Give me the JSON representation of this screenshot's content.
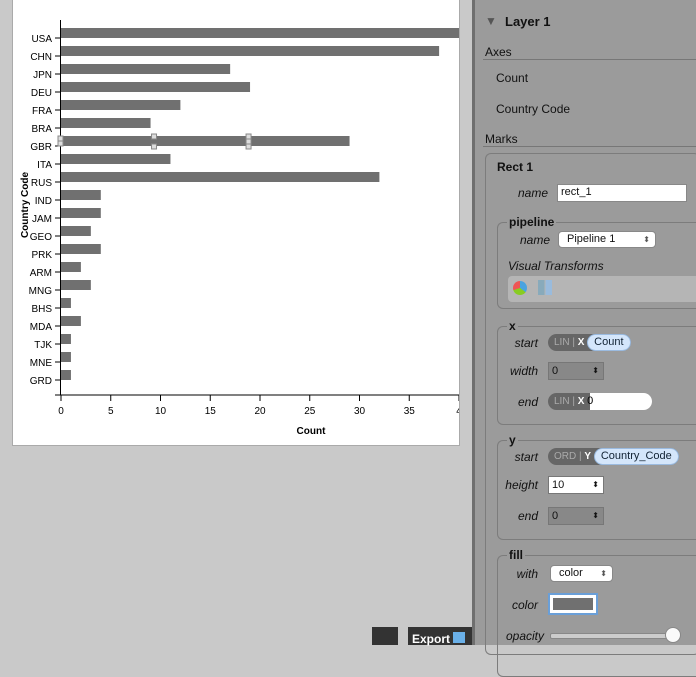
{
  "chart_data": {
    "type": "bar",
    "orientation": "horizontal",
    "categories": [
      "USA",
      "CHN",
      "JPN",
      "DEU",
      "FRA",
      "BRA",
      "GBR",
      "ITA",
      "RUS",
      "IND",
      "JAM",
      "GEO",
      "PRK",
      "ARM",
      "MNG",
      "BHS",
      "MDA",
      "TJK",
      "MNE",
      "GRD"
    ],
    "values": [
      40,
      38,
      17,
      19,
      12,
      9,
      29,
      11,
      32,
      4,
      4,
      3,
      4,
      2,
      3,
      1,
      2,
      1,
      1,
      1
    ],
    "xlabel": "Count",
    "ylabel": "Country Code",
    "xlim": [
      0,
      40
    ],
    "xticks": [
      "0",
      "5",
      "10",
      "15",
      "20",
      "25",
      "30",
      "35",
      "4"
    ],
    "bar_color": "#707070",
    "grid": false
  },
  "panel": {
    "layer_title": "Layer 1",
    "axes_heading": "Axes",
    "axes": [
      "Count",
      "Country Code"
    ],
    "marks_heading": "Marks",
    "mark_title": "Rect 1",
    "name_label": "name",
    "name_value": "rect_1",
    "pipeline_heading": "pipeline",
    "pipeline_name_label": "name",
    "pipeline_value": "Pipeline 1",
    "visual_transforms": "Visual Transforms",
    "x": {
      "heading": "x",
      "start_label": "start",
      "start_scale": "LIN",
      "start_axis": "X",
      "start_field": "Count",
      "width_label": "width",
      "width_value": "0",
      "end_label": "end",
      "end_scale": "LIN",
      "end_axis": "X",
      "end_value": "0"
    },
    "y": {
      "heading": "y",
      "start_label": "start",
      "start_scale": "ORD",
      "start_axis": "Y",
      "start_field": "Country_Code",
      "height_label": "height",
      "height_value": "10",
      "end_label": "end",
      "end_value": "0"
    },
    "fill": {
      "heading": "fill",
      "with_label": "with",
      "with_value": "color",
      "color_label": "color",
      "color_value": "#707070",
      "opacity_label": "opacity",
      "opacity": 1.0
    }
  },
  "footer": {
    "export_label": "Export"
  }
}
